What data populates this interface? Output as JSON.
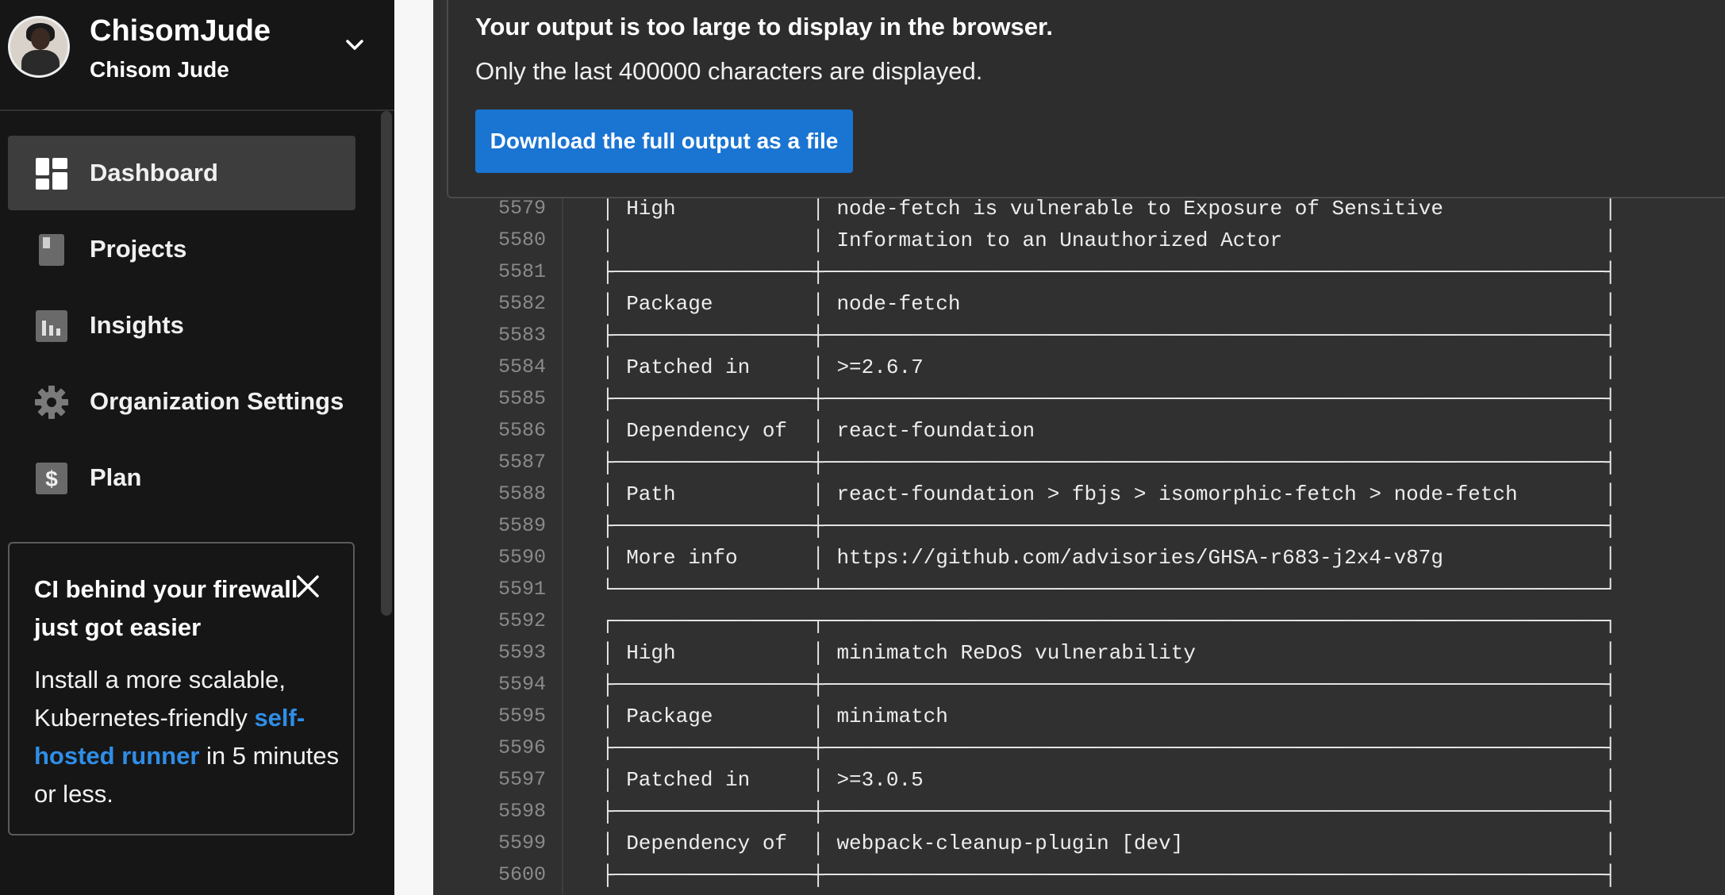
{
  "account": {
    "username": "ChisomJude",
    "display_name": "Chisom Jude"
  },
  "nav": [
    {
      "label": "Dashboard",
      "icon": "dashboard-icon",
      "active": true
    },
    {
      "label": "Projects",
      "icon": "projects-icon",
      "active": false
    },
    {
      "label": "Insights",
      "icon": "insights-icon",
      "active": false
    },
    {
      "label": "Organization Settings",
      "icon": "gear-icon",
      "active": false
    },
    {
      "label": "Plan",
      "icon": "dollar-icon",
      "active": false
    }
  ],
  "promo": {
    "title": "CI behind your firewall just got easier",
    "body_before": "Install a more scalable, Kubernetes-friendly ",
    "link": "self-hosted runner",
    "body_after": " in 5 minutes or less."
  },
  "banner": {
    "title": "Your output is too large to display in the browser.",
    "subtitle": "Only the last 400000 characters are displayed.",
    "button": "Download the full output as a file"
  },
  "output_lines": [
    {
      "n": "5579",
      "text": "│ High           │ node-fetch is vulnerable to Exposure of Sensitive             │"
    },
    {
      "n": "5580",
      "text": "│                │ Information to an Unauthorized Actor                          │"
    },
    {
      "n": "5581",
      "text": "├────────────────┼───────────────────────────────────────────────────────────────┤"
    },
    {
      "n": "5582",
      "text": "│ Package        │ node-fetch                                                    │"
    },
    {
      "n": "5583",
      "text": "├────────────────┼───────────────────────────────────────────────────────────────┤"
    },
    {
      "n": "5584",
      "text": "│ Patched in     │ >=2.6.7                                                       │"
    },
    {
      "n": "5585",
      "text": "├────────────────┼───────────────────────────────────────────────────────────────┤"
    },
    {
      "n": "5586",
      "text": "│ Dependency of  │ react-foundation                                              │"
    },
    {
      "n": "5587",
      "text": "├────────────────┼───────────────────────────────────────────────────────────────┤"
    },
    {
      "n": "5588",
      "text": "│ Path           │ react-foundation > fbjs > isomorphic-fetch > node-fetch       │"
    },
    {
      "n": "5589",
      "text": "├────────────────┼───────────────────────────────────────────────────────────────┤"
    },
    {
      "n": "5590",
      "text": "│ More info      │ https://github.com/advisories/GHSA-r683-j2x4-v87g             │"
    },
    {
      "n": "5591",
      "text": "└────────────────┴───────────────────────────────────────────────────────────────┘"
    },
    {
      "n": "5592",
      "text": "┌────────────────┬───────────────────────────────────────────────────────────────┐"
    },
    {
      "n": "5593",
      "text": "│ High           │ minimatch ReDoS vulnerability                                 │"
    },
    {
      "n": "5594",
      "text": "├────────────────┼───────────────────────────────────────────────────────────────┤"
    },
    {
      "n": "5595",
      "text": "│ Package        │ minimatch                                                     │"
    },
    {
      "n": "5596",
      "text": "├────────────────┼───────────────────────────────────────────────────────────────┤"
    },
    {
      "n": "5597",
      "text": "│ Patched in     │ >=3.0.5                                                       │"
    },
    {
      "n": "5598",
      "text": "├────────────────┼───────────────────────────────────────────────────────────────┤"
    },
    {
      "n": "5599",
      "text": "│ Dependency of  │ webpack-cleanup-plugin [dev]                                  │"
    },
    {
      "n": "5600",
      "text": "├────────────────┼───────────────────────────────────────────────────────────────┤"
    }
  ]
}
